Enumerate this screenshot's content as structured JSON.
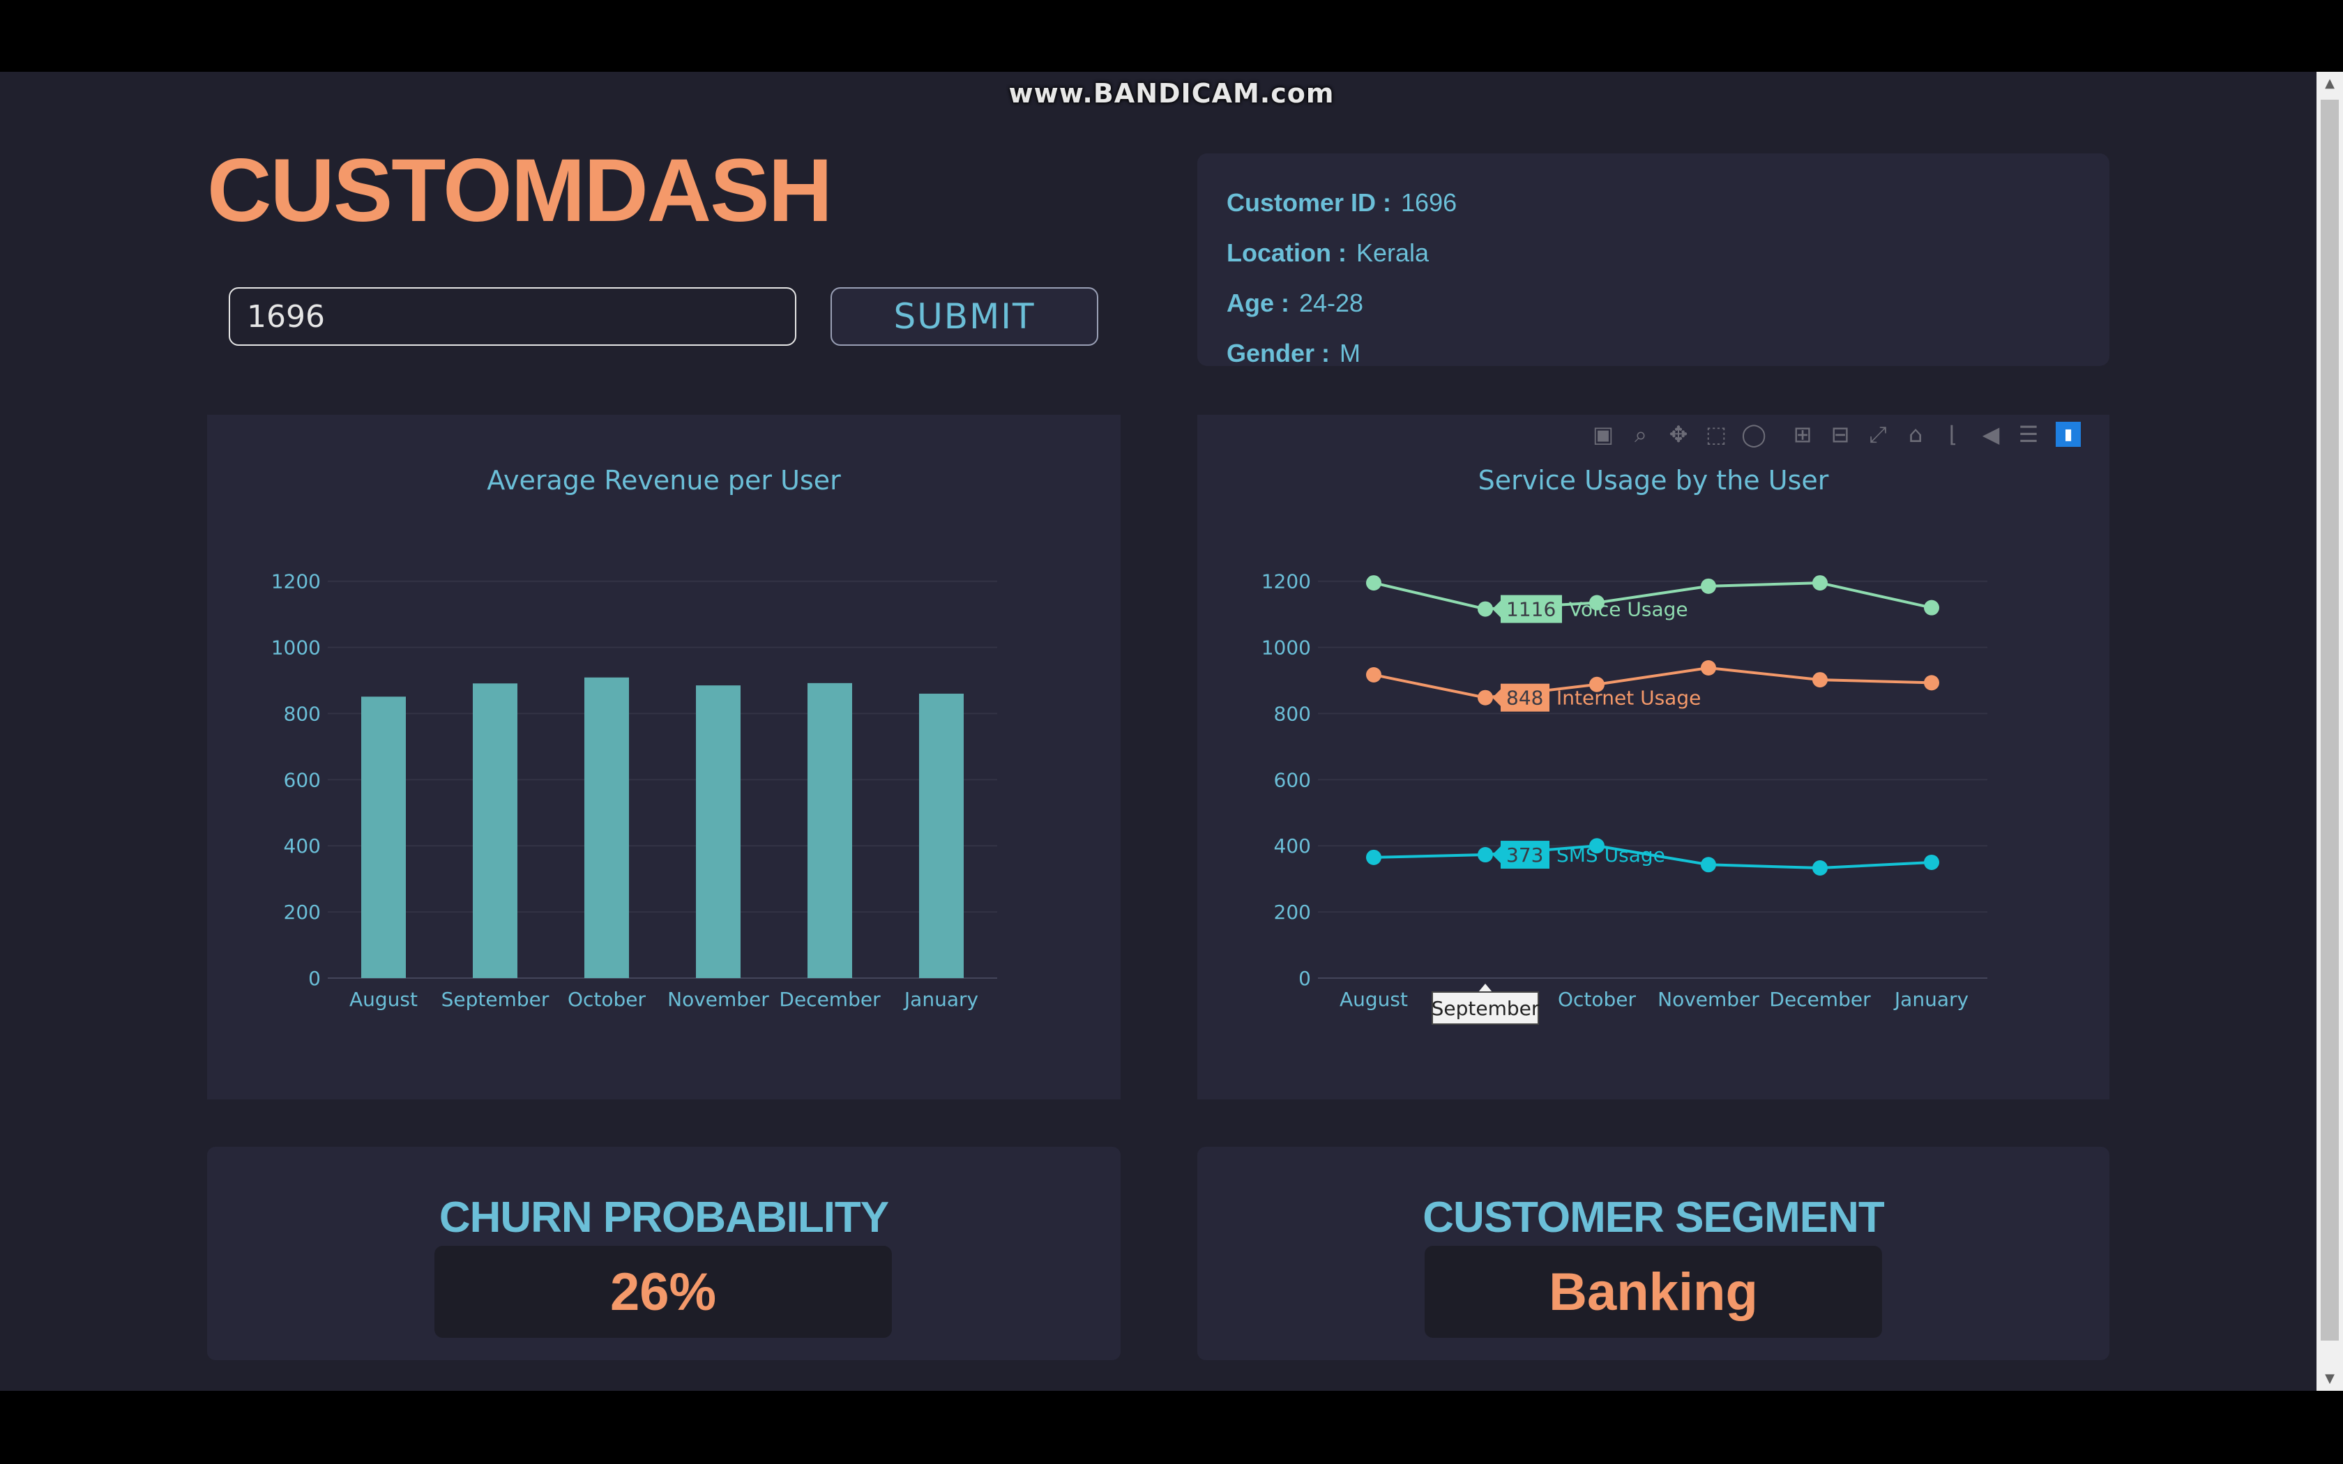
{
  "watermark": "www.BANDICAM.com",
  "brand": "CUSTOMDASH",
  "search": {
    "value": "1696",
    "submit_label": "SUBMIT"
  },
  "customer": {
    "id_label": "Customer ID :",
    "id": "1696",
    "location_label": "Location :",
    "location": "Kerala",
    "age_label": "Age :",
    "age": "24-28",
    "gender_label": "Gender :",
    "gender": "M"
  },
  "modebar": [
    "camera-icon",
    "zoom-icon",
    "pan-icon",
    "box-select-icon",
    "lasso-icon",
    "zoom-in-icon",
    "zoom-out-icon",
    "autoscale-icon",
    "reset-axes-icon",
    "spike-lines-icon",
    "hover-closest-icon",
    "hover-compare-icon",
    "plotly-logo-icon"
  ],
  "churn": {
    "title": "CHURN PROBABILITY",
    "value": "26%"
  },
  "segment": {
    "title": "CUSTOMER SEGMENT",
    "value": "Banking"
  },
  "colors": {
    "bar": "#5faeb1",
    "voice": "#8fdcb0",
    "internet": "#f4996a",
    "sms": "#13c3d6",
    "accent": "#6bbfd8"
  },
  "chart_data": [
    {
      "type": "bar",
      "title": "Average Revenue per User",
      "categories": [
        "August",
        "September",
        "October",
        "November",
        "December",
        "January"
      ],
      "values": [
        851,
        891,
        909,
        885,
        892,
        860
      ],
      "ylim": [
        0,
        1250
      ],
      "yticks": [
        0,
        200,
        400,
        600,
        800,
        1000,
        1200
      ],
      "grid": true
    },
    {
      "type": "line",
      "title": "Service Usage by the User",
      "categories": [
        "August",
        "September",
        "October",
        "November",
        "December",
        "January"
      ],
      "ylim": [
        0,
        1250
      ],
      "yticks": [
        0,
        200,
        400,
        600,
        800,
        1000,
        1200
      ],
      "series": [
        {
          "name": "Voice Usage",
          "values": [
            1195,
            1116,
            1135,
            1185,
            1195,
            1120
          ]
        },
        {
          "name": "Internet Usage",
          "values": [
            917,
            848,
            888,
            938,
            902,
            893
          ]
        },
        {
          "name": "SMS Usage",
          "values": [
            365,
            373,
            400,
            343,
            333,
            350
          ]
        }
      ],
      "hover": {
        "category": "September",
        "labels": [
          "1116",
          "848",
          "373"
        ]
      },
      "grid": true
    }
  ]
}
